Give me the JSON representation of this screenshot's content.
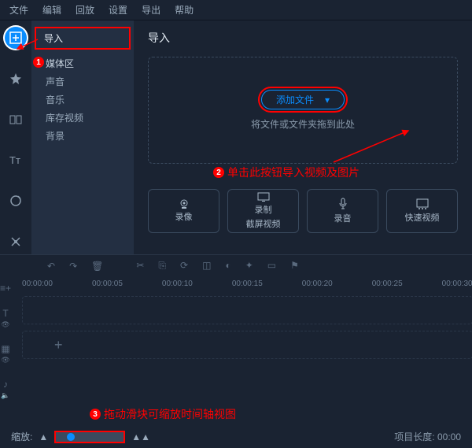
{
  "menu": {
    "file": "文件",
    "edit": "编辑",
    "playback": "回放",
    "settings": "设置",
    "export": "导出",
    "help": "帮助"
  },
  "sidepanel": {
    "head": "导入",
    "items": {
      "media": "媒体区",
      "sound": "声音",
      "music": "音乐",
      "stock": "库存视频",
      "bg": "背景"
    }
  },
  "content": {
    "title": "导入",
    "addfile": "添加文件",
    "droptext": "将文件或文件夹拖到此处"
  },
  "annotations": {
    "badge1": "1",
    "badge2": "2",
    "badge3": "3",
    "hint1": "单击此按钮导入视频及图片",
    "hint2": "拖动滑块可缩放时间轴视图"
  },
  "cards": {
    "rec": "录像",
    "screen1": "录制",
    "screen2": "截屏视频",
    "audio": "录音",
    "quick": "快速视频"
  },
  "timeline": {
    "marks": [
      "00:00:00",
      "00:00:05",
      "00:00:10",
      "00:00:15",
      "00:00:20",
      "00:00:25",
      "00:00:30"
    ]
  },
  "bottom": {
    "zoom": "缩放:",
    "length_label": "项目长度:",
    "length_value": "00:00"
  }
}
